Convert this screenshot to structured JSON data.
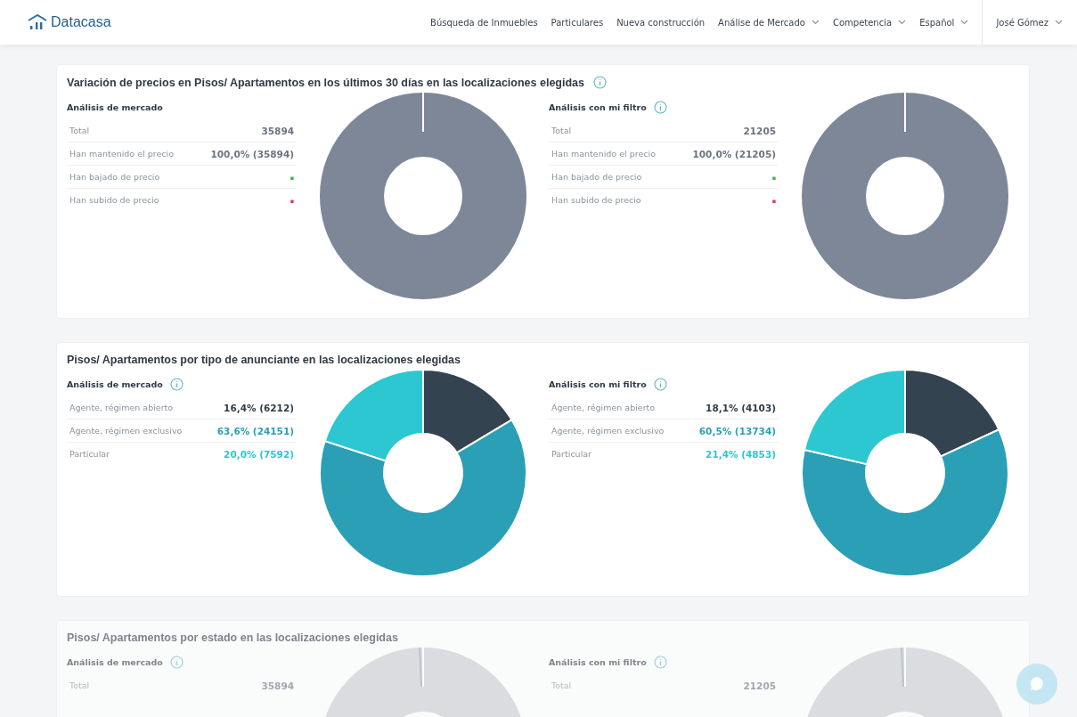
{
  "brand": {
    "name": "Datacasa"
  },
  "nav": [
    {
      "label": "Búsqueda de Inmuebles",
      "has_menu": false
    },
    {
      "label": "Particulares",
      "has_menu": false
    },
    {
      "label": "Nueva construcción",
      "has_menu": false
    },
    {
      "label": "Análise de Mercado",
      "has_menu": true
    },
    {
      "label": "Competencia",
      "has_menu": true
    },
    {
      "label": "Español",
      "has_menu": true
    }
  ],
  "user": {
    "name": "José Gómez",
    "has_menu": true
  },
  "sections": [
    {
      "title": "Variación de precios en Pisos/ Apartamentos en los últimos 30 días en las localizaciones elegidas",
      "info": true,
      "faded": false,
      "panels": [
        {
          "heading": "Análisis de mercado",
          "info": false,
          "rows": [
            {
              "label": "Total",
              "value": "35894",
              "color": "#6b7480"
            },
            {
              "label": "Han mantenido el precio",
              "value": "100,0% (35894)",
              "color": "#6b7480"
            },
            {
              "label": "Han bajado de precio",
              "value": "-",
              "color": "#4caf50"
            },
            {
              "label": "Han subido de precio",
              "value": "-",
              "color": "#e53950"
            }
          ]
        },
        {
          "heading": "Análisis con mi filtro",
          "info": true,
          "rows": [
            {
              "label": "Total",
              "value": "21205",
              "color": "#6b7480"
            },
            {
              "label": "Han mantenido el precio",
              "value": "100,0% (21205)",
              "color": "#6b7480"
            },
            {
              "label": "Han bajado de precio",
              "value": "-",
              "color": "#4caf50"
            },
            {
              "label": "Han subido de precio",
              "value": "-",
              "color": "#e53950"
            }
          ]
        }
      ]
    },
    {
      "title": "Pisos/ Apartamentos por tipo de anunciante en las localizaciones elegidas",
      "info": false,
      "faded": false,
      "panels": [
        {
          "heading": "Análisis de mercado",
          "info": true,
          "rows": [
            {
              "label": "Agente, régimen abierto",
              "value": "16,4% (6212)",
              "color": "#2f3d49"
            },
            {
              "label": "Agente, régimen exclusivo",
              "value": "63,6% (24151)",
              "color": "#2a9fb5"
            },
            {
              "label": "Particular",
              "value": "20,0% (7592)",
              "color": "#2cc7d1"
            }
          ],
          "chart_data": {
            "type": "donut",
            "values": [
              16.4,
              63.6,
              20.0
            ],
            "colors": [
              "#33434f",
              "#2a9fb5",
              "#2cc7d1"
            ]
          }
        },
        {
          "heading": "Análisis con mi filtro",
          "info": true,
          "rows": [
            {
              "label": "Agente, régimen abierto",
              "value": "18,1% (4103)",
              "color": "#2f3d49"
            },
            {
              "label": "Agente, régimen exclusivo",
              "value": "60,5% (13734)",
              "color": "#2a9fb5"
            },
            {
              "label": "Particular",
              "value": "21,4% (4853)",
              "color": "#2cc7d1"
            }
          ],
          "chart_data": {
            "type": "donut",
            "values": [
              18.1,
              60.5,
              21.4
            ],
            "colors": [
              "#33434f",
              "#2a9fb5",
              "#2cc7d1"
            ]
          }
        }
      ]
    },
    {
      "title": "Pisos/ Apartamentos por estado en las localizaciones elegidas",
      "info": false,
      "faded": true,
      "panels": [
        {
          "heading": "Análisis de mercado",
          "info": true,
          "rows": [
            {
              "label": "Total",
              "value": "35894"
            }
          ]
        },
        {
          "heading": "Análisis con mi filtro",
          "info": true,
          "rows": [
            {
              "label": "Total",
              "value": "21205"
            }
          ]
        }
      ]
    }
  ]
}
